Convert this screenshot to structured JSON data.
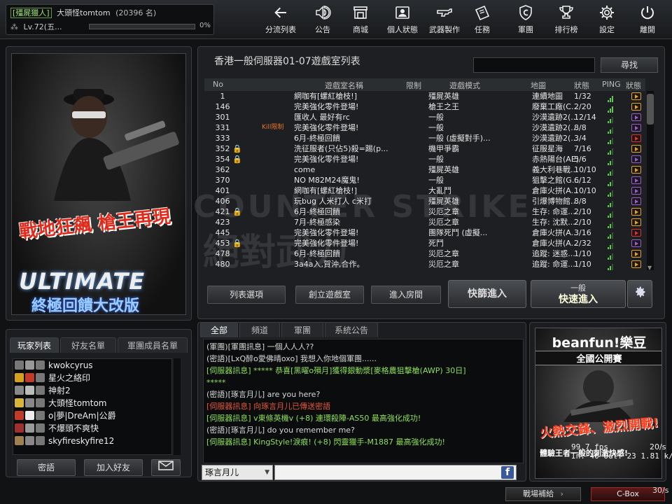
{
  "player": {
    "class_tag": "[殭屍獵人]",
    "name": "大頭怪tomtom",
    "rank": "(20396 名)",
    "level": "Lv.72(五...",
    "xp_percent": "0%",
    "xp_fraction": 0.0
  },
  "nav": [
    {
      "label": "分流列表",
      "icon": "arrow-left"
    },
    {
      "label": "公告",
      "icon": "speaker"
    },
    {
      "label": "商城",
      "icon": "shop"
    },
    {
      "label": "個人狀態",
      "icon": "profile-card"
    },
    {
      "label": "武器製作",
      "icon": "gun"
    },
    {
      "label": "任務",
      "icon": "ticket"
    },
    {
      "label": "軍團",
      "icon": "shield-c"
    },
    {
      "label": "排行榜",
      "icon": "trophy"
    },
    {
      "label": "設定",
      "icon": "gear"
    },
    {
      "label": "離開",
      "icon": "power"
    }
  ],
  "banner": {
    "red_text": "戰地狂飆 槍王再現",
    "ultimate": "ULTIMATE",
    "sub": "終極回饋大改版"
  },
  "room_list": {
    "title": "香港一般伺服器01-07遊戲室列表",
    "search_label": "尋找",
    "search_value": "",
    "headers": {
      "no": "No",
      "name": "遊戲室名稱",
      "limit": "限制",
      "mode": "遊戲模式",
      "map": "地圖",
      "status": "狀態",
      "ping": "PING",
      "state": "狀態"
    },
    "rows": [
      {
        "no": "1",
        "lock": false,
        "limit": "",
        "name": "網咖有[螺紅槍枝!]",
        "mode": "殭屍英雄",
        "map": "連續地圖",
        "status": "1/32",
        "ping": 3,
        "state": "orange"
      },
      {
        "no": "146",
        "lock": false,
        "limit": "",
        "name": "完美強化零件登場!",
        "mode": "槍王之王",
        "map": "廢棄工廠(C...",
        "status": "2/20",
        "ping": 3,
        "state": "orange"
      },
      {
        "no": "301",
        "lock": false,
        "limit": "",
        "name": "匯收人 最好有rc",
        "mode": "一般",
        "map": "沙漠遺跡2(...",
        "status": "12/14",
        "ping": 2,
        "state": "purple"
      },
      {
        "no": "331",
        "lock": false,
        "limit": "Kill限制",
        "name": "完美強化零件登場!",
        "mode": "一般",
        "map": "沙漠遺跡2(...",
        "status": "8/8",
        "ping": 2,
        "state": "purple"
      },
      {
        "no": "333",
        "lock": false,
        "limit": "",
        "name": "6月-終極回饋",
        "mode": "一般 (虛擬對手)...",
        "map": "沙漠遺跡2(...",
        "status": "3/4",
        "ping": 2,
        "state": "red"
      },
      {
        "no": "352",
        "lock": true,
        "limit": "",
        "name": "洗征服者(只佔5)殺=踢(p...",
        "mode": "機甲爭霸",
        "map": "征服星海",
        "status": "7/16",
        "ping": 2,
        "state": "orange"
      },
      {
        "no": "354",
        "lock": true,
        "limit": "",
        "name": "完美強化零件登場!",
        "mode": "一般",
        "map": "赤熱陽台(AE)",
        "status": "5/6",
        "ping": 2,
        "state": "purple"
      },
      {
        "no": "362",
        "lock": false,
        "limit": "",
        "name": "come",
        "mode": "殭屍英雄",
        "map": "義大利巷戰...",
        "status": "10/10",
        "ping": 2,
        "state": "orange"
      },
      {
        "no": "370",
        "lock": false,
        "limit": "",
        "name": "NO M82M24魔鬼!",
        "mode": "一般",
        "map": "狙擊之館(G...",
        "status": "6/12",
        "ping": 2,
        "state": "purple"
      },
      {
        "no": "401",
        "lock": false,
        "limit": "",
        "name": "網咖有[螺紅槍枝!]",
        "mode": "大亂鬥",
        "map": "倉庫火拼(A...",
        "status": "10/10",
        "ping": 2,
        "state": "purple"
      },
      {
        "no": "406",
        "lock": false,
        "limit": "",
        "name": "玩bug 人米打人 c米打",
        "mode": "殭屍英雄",
        "map": "引爆博物館...",
        "status": "8/8",
        "ping": 2,
        "state": "purple"
      },
      {
        "no": "421",
        "lock": true,
        "limit": "",
        "name": "6月-終極回饋",
        "mode": "災厄之章",
        "map": "生存: 命運...",
        "status": "2/10",
        "ping": 2,
        "state": "orange"
      },
      {
        "no": "423",
        "lock": false,
        "limit": "",
        "name": "7月-終極感染",
        "mode": "災厄之章",
        "map": "生存: 沈默...",
        "status": "2/10",
        "ping": 2,
        "state": "orange"
      },
      {
        "no": "445",
        "lock": false,
        "limit": "",
        "name": "完美強化零件登場!",
        "mode": "團隊死鬥 (虛擬...",
        "map": "倉庫火拼(A...",
        "status": "3/16",
        "ping": 2,
        "state": "red"
      },
      {
        "no": "453",
        "lock": true,
        "limit": "",
        "name": "完美強化零件登場!",
        "mode": "死鬥",
        "map": "倉庫火拼(A...",
        "status": "2/32",
        "ping": 2,
        "state": "purple"
      },
      {
        "no": "478",
        "lock": false,
        "limit": "",
        "name": "6月-終極回饋",
        "mode": "災厄之章",
        "map": "追蹤: 迷惑...",
        "status": "1/10",
        "ping": 2,
        "state": "orange"
      },
      {
        "no": "480",
        "lock": false,
        "limit": "",
        "name": "3a4a入,賀沖,合作。",
        "mode": "災厄之章",
        "map": "追蹤: 命運...",
        "status": "1/10",
        "ping": 2,
        "state": "orange"
      }
    ],
    "buttons": {
      "options": "列表選項",
      "create": "創立遊戲室",
      "enter": "進入房間",
      "quick_join": "快篩進入",
      "mode_label": "一般",
      "quick_start": "快速進入"
    }
  },
  "watermark": {
    "line1": "COUNTER STRIKE",
    "line2": "絕對武力"
  },
  "players": {
    "tabs": [
      "玩家列表",
      "好友名單",
      "軍團成員名單"
    ],
    "list": [
      {
        "name": "kwokcyrus",
        "c1": "#777",
        "c2": "#999"
      },
      {
        "name": "星火之絡印",
        "c1": "#d4a020",
        "c2": "#c23a2a"
      },
      {
        "name": "神射2",
        "c1": "#888",
        "c2": "#bbb"
      },
      {
        "name": "大頭怪tomtom",
        "c1": "#d8b43a",
        "c2": "#888"
      },
      {
        "name": "o|夢|DreAm|公爵",
        "c1": "#c23a2a",
        "c2": "#eee"
      },
      {
        "name": "不爆頭不爽快",
        "c1": "#a03030",
        "c2": "#999"
      },
      {
        "name": "skyfireskyfire12",
        "c1": "#a08050",
        "c2": "#888"
      }
    ],
    "btn_whisper": "密語",
    "btn_add_friend": "加入好友"
  },
  "chat": {
    "tabs": [
      "全部",
      "頻道",
      "軍團",
      "系統公告"
    ],
    "lines": [
      {
        "text": "(軍團)[軍團訊息] 一個人人人??",
        "cls": "cw"
      },
      {
        "text": "(密語)[LxQ醉o愛佛晴oxo] 我想入你地個軍團......",
        "cls": "cw"
      },
      {
        "text": "[伺服器訊息] ***** 恭喜[黑曜o殞月]獲得銀動漿[麥格農狙擊槍(AWP) 30日]",
        "cls": "cg"
      },
      {
        "text": "*****",
        "cls": "cg"
      },
      {
        "text": "(密語)[琢言月儿] are you here?",
        "cls": "cw"
      },
      {
        "text": "[伺服器訊息] 向琢言月儿已傳送密語",
        "cls": "cr"
      },
      {
        "text": "[伺服器訊息] v東條英機v (+8) 連環殺陣-AS50 最高強化成功!",
        "cls": "cg"
      },
      {
        "text": "(密語)[琢言月儿] do you remember me?",
        "cls": "cw"
      },
      {
        "text": "[伺服器訊息] KingStyle!淚痕! (+8) 閃靈獵手-M1887 最高強化成功!",
        "cls": "cg"
      }
    ],
    "target": "琢言月儿",
    "input_value": "",
    "fb_label": "f"
  },
  "ad": {
    "brand": "beanfun!樂豆",
    "sub": "全國公開賽",
    "red": "火熱交鋒、激烈開戰!",
    "small": "體驗王者一般的刺激快感!"
  },
  "perf": {
    "line1": "99.7 fps",
    "line2": "In:   40 Out:   23 1.81 k/s",
    "right": "20/s"
  },
  "bottom": {
    "supply": "戰場補給",
    "cbox": "C-Box",
    "fps_small": "30/s"
  }
}
